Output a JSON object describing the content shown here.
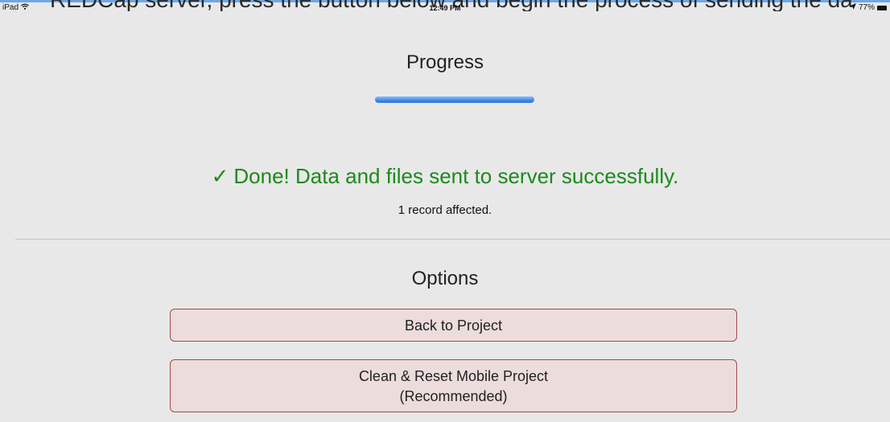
{
  "status_bar": {
    "device": "iPad",
    "wifi_icon": "wifi-icon",
    "time": "12:49 PM",
    "location_icon": "location-arrow-icon",
    "battery": "77%",
    "battery_icon": "battery-icon"
  },
  "background_text": "REDCap server, press the button below and begin the process of sending the data.",
  "progress": {
    "title": "Progress",
    "value": 1.0
  },
  "result": {
    "check_icon": "checkmark-icon",
    "check_glyph": "✓",
    "message": "Done! Data and files sent to server successfully.",
    "detail": "1 record affected."
  },
  "options": {
    "title": "Options",
    "back_button": "Back to Project",
    "clean_button_line1": "Clean & Reset Mobile Project",
    "clean_button_line2": "(Recommended)"
  },
  "colors": {
    "success": "#1c8a1c",
    "progress": "#3f8ae8",
    "button_border": "#a24a4a",
    "button_fill": "#ecdcdc"
  }
}
